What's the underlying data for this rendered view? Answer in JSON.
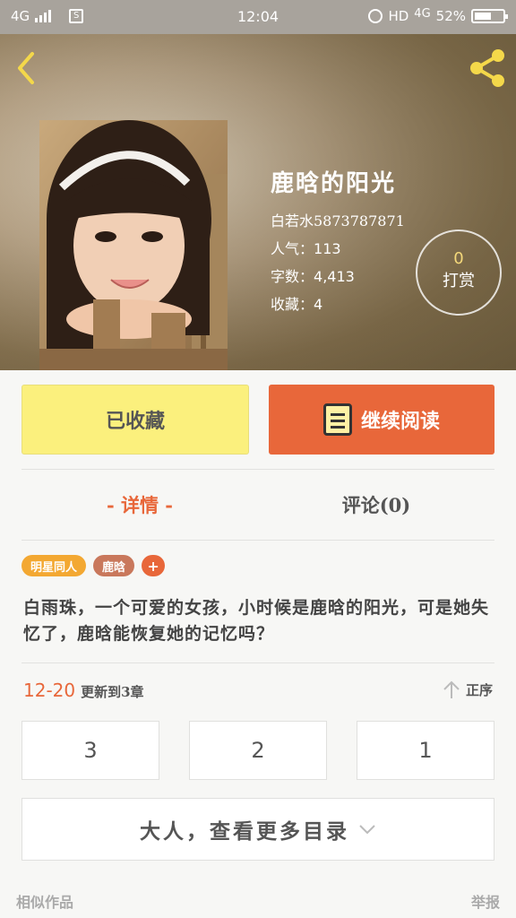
{
  "status_bar": {
    "network_left": "4G",
    "sim_label": "S",
    "time": "12:04",
    "hd": "HD",
    "network_right": "4G",
    "battery": "52%"
  },
  "header": {
    "back_icon": "chevron-left-icon",
    "share_icon": "share-icon"
  },
  "book": {
    "title": "鹿晗的阳光",
    "author": "白若水5873787871",
    "popularity_label": "人气：",
    "popularity": "113",
    "words_label": "字数：",
    "words": "4,413",
    "favorites_label": "收藏：",
    "favorites": "4"
  },
  "tip": {
    "count": "0",
    "label": "打赏"
  },
  "actions": {
    "favorite_label": "已收藏",
    "read_label": "继续阅读",
    "read_icon": "book-icon"
  },
  "tabs": {
    "detail": "- 详情 -",
    "comment": "评论(0)"
  },
  "tags": [
    "明星同人",
    "鹿晗"
  ],
  "tag_add": "+",
  "description": "白雨珠，一个可爱的女孩，小时候是鹿晗的阳光，可是她失忆了，鹿晗能恢复她的记忆吗？",
  "update": {
    "date": "12-20",
    "text": "更新到3章",
    "order_label": "正序",
    "order_icon": "arrow-up-icon"
  },
  "chapters": [
    "3",
    "2",
    "1"
  ],
  "more_catalog": "大人，查看更多目录",
  "footer": {
    "similar": "相似作品",
    "report": "举报"
  },
  "colors": {
    "accent": "#e8673a",
    "favorite_bg": "#fbf07d",
    "tag_orange": "#f3a832",
    "tag_brown": "#c9785c",
    "icon_yellow": "#f4d84a"
  }
}
